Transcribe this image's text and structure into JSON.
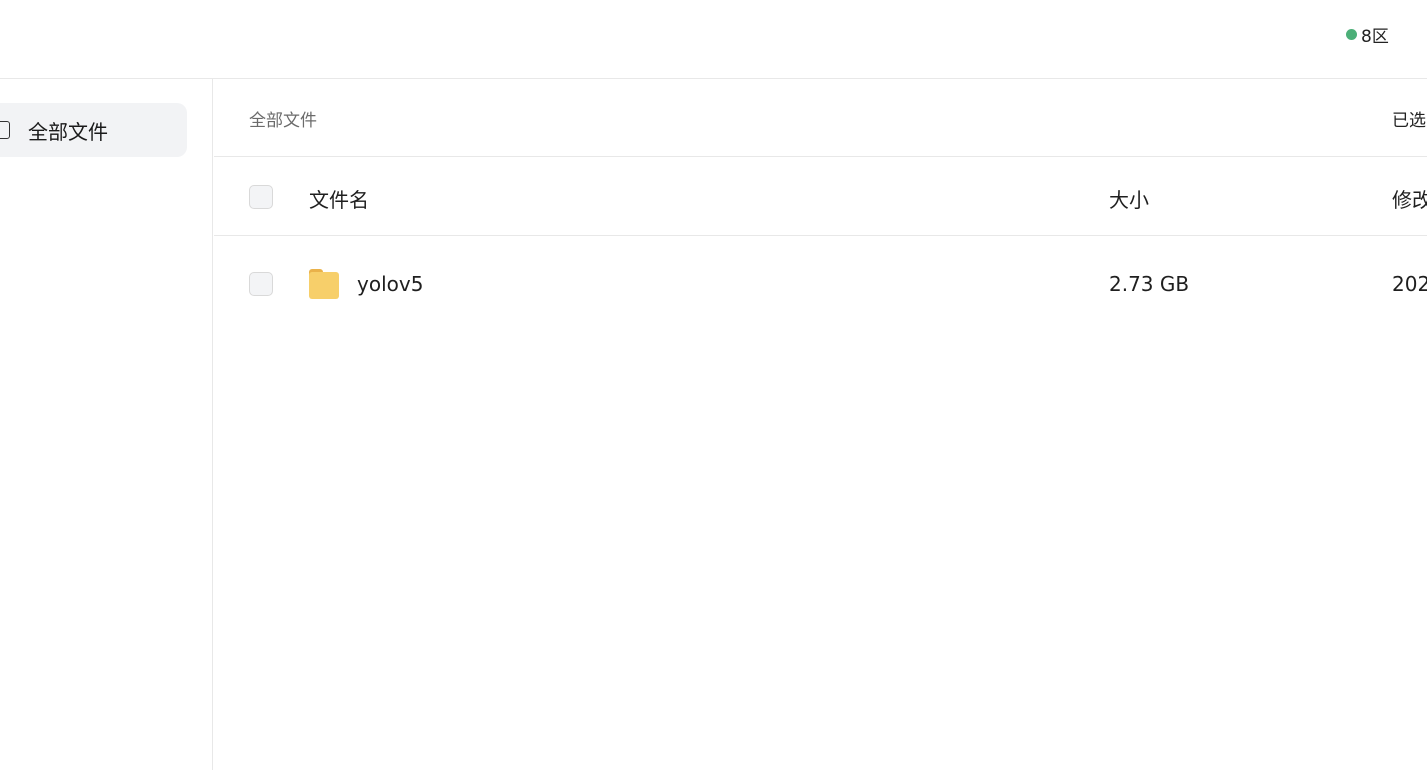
{
  "header": {
    "region": {
      "label": "8区",
      "dot_color": "#4caf78"
    }
  },
  "sidebar": {
    "items": [
      {
        "label": "全部文件",
        "icon": "folder-outline-icon",
        "active": true,
        "bg": "#f2f3f5"
      }
    ]
  },
  "main": {
    "breadcrumb": "全部文件",
    "selected_label": "已选",
    "table": {
      "columns": [
        "文件名",
        "大小",
        "修改"
      ],
      "rows": [
        {
          "name": "yolov5",
          "size": "2.73 GB",
          "modified": "202",
          "icon": "folder-icon"
        }
      ]
    }
  },
  "colors": {
    "folder_body": "#f7cf6a",
    "folder_tab": "#eab24a",
    "border": "#e8e8e8"
  }
}
